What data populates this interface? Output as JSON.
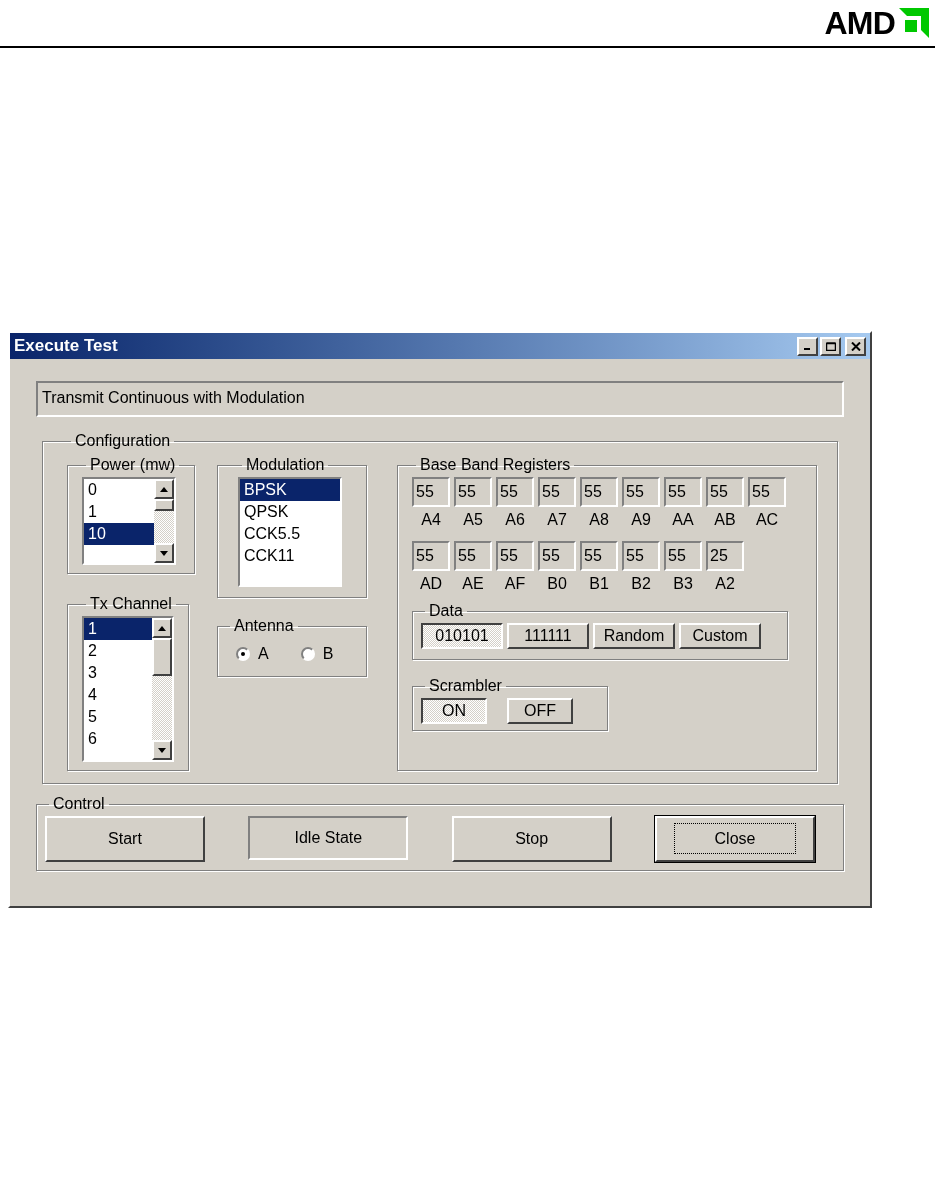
{
  "header": {
    "logo": "AMD"
  },
  "window": {
    "title": "Execute Test",
    "status": "Transmit Continuous with Modulation"
  },
  "configuration": {
    "title": "Configuration",
    "power": {
      "title": "Power (mw)",
      "items": [
        {
          "label": "0",
          "selected": false
        },
        {
          "label": "1",
          "selected": false
        },
        {
          "label": "10",
          "selected": true
        }
      ]
    },
    "modulation": {
      "title": "Modulation",
      "items": [
        {
          "label": "BPSK",
          "selected": true
        },
        {
          "label": "QPSK",
          "selected": false
        },
        {
          "label": "CCK5.5",
          "selected": false
        },
        {
          "label": "CCK11",
          "selected": false
        }
      ]
    },
    "tx_channel": {
      "title": "Tx Channel",
      "items": [
        {
          "label": "1",
          "selected": true
        },
        {
          "label": "2",
          "selected": false
        },
        {
          "label": "3",
          "selected": false
        },
        {
          "label": "4",
          "selected": false
        },
        {
          "label": "5",
          "selected": false
        },
        {
          "label": "6",
          "selected": false
        }
      ]
    },
    "antenna": {
      "title": "Antenna",
      "options": [
        {
          "label": "A",
          "selected": true
        },
        {
          "label": "B",
          "selected": false
        }
      ]
    },
    "base_band_registers": {
      "title": "Base Band Registers",
      "rows": [
        [
          {
            "value": "55",
            "label": "A4"
          },
          {
            "value": "55",
            "label": "A5"
          },
          {
            "value": "55",
            "label": "A6"
          },
          {
            "value": "55",
            "label": "A7"
          },
          {
            "value": "55",
            "label": "A8"
          },
          {
            "value": "55",
            "label": "A9"
          },
          {
            "value": "55",
            "label": "AA"
          },
          {
            "value": "55",
            "label": "AB"
          },
          {
            "value": "55",
            "label": "AC"
          }
        ],
        [
          {
            "value": "55",
            "label": "AD"
          },
          {
            "value": "55",
            "label": "AE"
          },
          {
            "value": "55",
            "label": "AF"
          },
          {
            "value": "55",
            "label": "B0"
          },
          {
            "value": "55",
            "label": "B1"
          },
          {
            "value": "55",
            "label": "B2"
          },
          {
            "value": "55",
            "label": "B3"
          },
          {
            "value": "25",
            "label": "A2"
          }
        ]
      ],
      "data": {
        "title": "Data",
        "buttons": [
          {
            "label": "010101",
            "selected": true
          },
          {
            "label": "111111",
            "selected": false
          },
          {
            "label": "Random",
            "selected": false
          },
          {
            "label": "Custom",
            "selected": false
          }
        ]
      },
      "scrambler": {
        "title": "Scrambler",
        "buttons": [
          {
            "label": "ON",
            "selected": true
          },
          {
            "label": "OFF",
            "selected": false
          }
        ]
      }
    }
  },
  "control": {
    "title": "Control",
    "items": [
      {
        "kind": "button",
        "label": "Start",
        "default": false
      },
      {
        "kind": "indicator",
        "label": "Idle State"
      },
      {
        "kind": "button",
        "label": "Stop",
        "default": false
      },
      {
        "kind": "button",
        "label": "Close",
        "default": true
      }
    ]
  }
}
